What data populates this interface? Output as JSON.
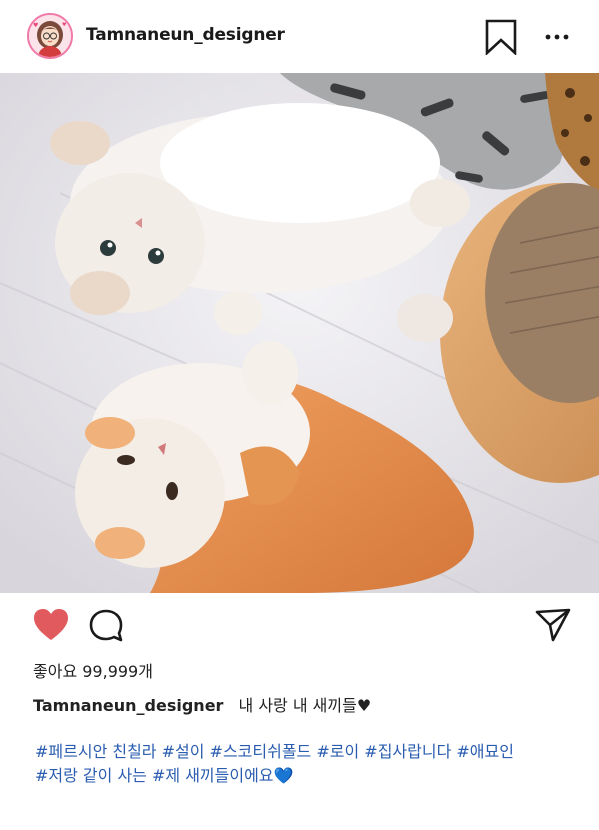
{
  "header": {
    "username": "Tamnaneun_designer"
  },
  "post": {
    "likes_text": "좋아요 99,999개",
    "caption_user": "Tamnaneun_designer",
    "caption_text": "내 사랑 내 새끼들♥",
    "hashtags_line1": "#페르시안 친칠라 #설이 #스코티쉬폴드 #로이 #집사랍니다 #애묘인",
    "hashtags_line2": "#저랑 같이 사는 #제 새끼들이에요💙"
  },
  "colors": {
    "like_red": "#e05a5e",
    "hashtag_blue": "#2a5db0",
    "avatar_ring": "#f07aa8"
  },
  "icons": {
    "bookmark": "bookmark-icon",
    "more": "more-dots-icon",
    "like": "heart-icon",
    "comment": "comment-bubble-icon",
    "share": "send-icon"
  }
}
